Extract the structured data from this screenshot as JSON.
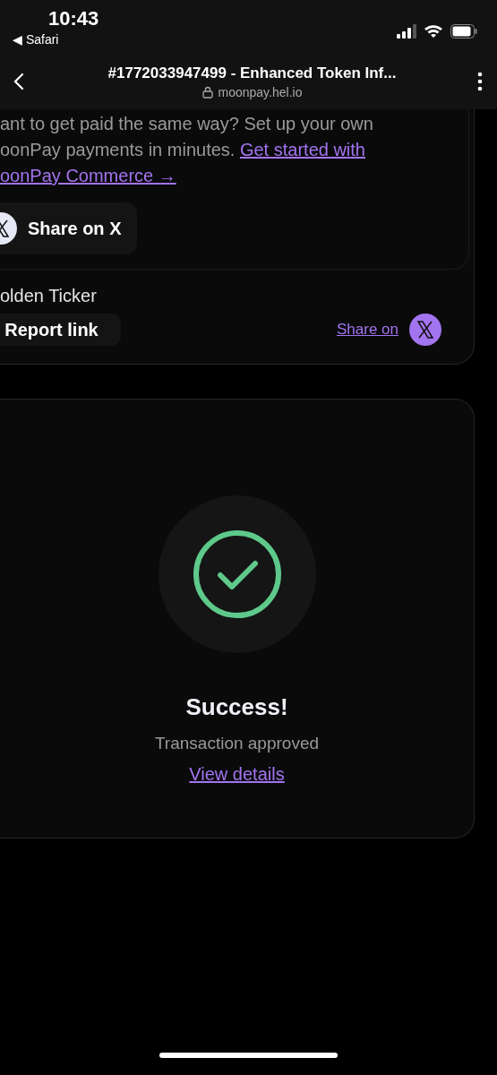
{
  "status_bar": {
    "time": "10:43",
    "back_app": "◀ Safari"
  },
  "browser": {
    "title": "#1772033947499 - Enhanced Token Inf...",
    "url": "moonpay.hel.io"
  },
  "promo": {
    "lines": [
      "ant to get paid the same way? Set up your own"
    ],
    "text": "oonPay payments in minutes.",
    "link_parts": [
      "Get started with",
      "oonPay Commerce →"
    ]
  },
  "share_button": {
    "label": "Share on X"
  },
  "merchant_name": "olden Ticker",
  "report_button": {
    "label": "Report link"
  },
  "share_link": {
    "label": "Share on"
  },
  "result": {
    "title": "Success!",
    "message": "Transaction approved",
    "link": "View details"
  }
}
